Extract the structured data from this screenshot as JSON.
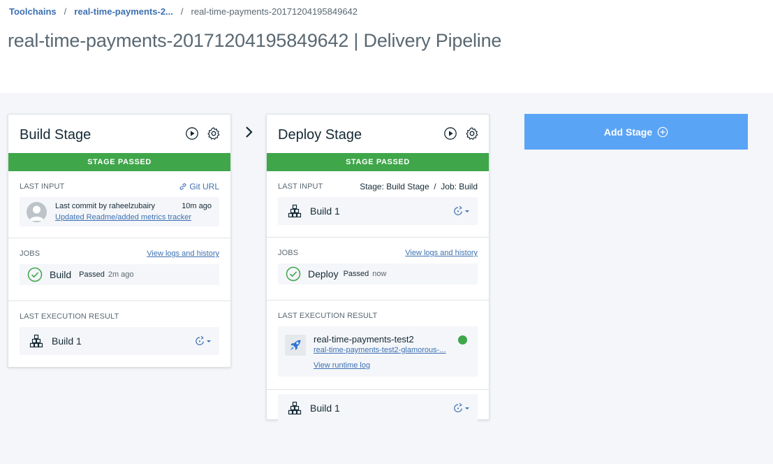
{
  "breadcrumb": {
    "root": "Toolchains",
    "parent": "real-time-payments-2...",
    "current": "real-time-payments-20171204195849642",
    "separator": "/"
  },
  "page": {
    "title": "real-time-payments-20171204195849642 | Delivery Pipeline"
  },
  "colors": {
    "accent": "#3d70b2",
    "passed": "#3fa64a",
    "add_stage": "#5aa4f5"
  },
  "build_stage": {
    "title": "Build Stage",
    "status": "STAGE PASSED",
    "last_input": {
      "label": "LAST INPUT",
      "git_link": "Git URL",
      "commit_by": "Last commit by raheelzubairy",
      "commit_time": "10m ago",
      "commit_message": "Updated Readme/added metrics tracker"
    },
    "jobs": {
      "label": "JOBS",
      "logs_link": "View logs and history",
      "job_name": "Build",
      "job_status": "Passed",
      "job_time": "2m ago"
    },
    "last_execution": {
      "label": "LAST EXECUTION RESULT",
      "build_name": "Build 1"
    }
  },
  "deploy_stage": {
    "title": "Deploy Stage",
    "status": "STAGE PASSED",
    "last_input": {
      "label": "LAST INPUT",
      "source": "Stage: Build Stage  /  Job: Build",
      "build_name": "Build 1"
    },
    "jobs": {
      "label": "JOBS",
      "logs_link": "View logs and history",
      "job_name": "Deploy",
      "job_status": "Passed",
      "job_time": "now"
    },
    "last_execution": {
      "label": "LAST EXECUTION RESULT",
      "app_name": "real-time-payments-test2",
      "app_url": "real-time-payments-test2-glamorous-...",
      "runtime_log": "View runtime log",
      "build_name": "Build 1"
    }
  },
  "add_stage": {
    "label": "Add Stage"
  },
  "icons": {
    "run": "play-icon",
    "settings": "gear-icon",
    "link": "link-icon",
    "success": "check-circle-icon",
    "build": "build-stack-icon",
    "redeploy": "redeploy-icon",
    "next": "chevron-right-icon",
    "add": "plus-circle-icon",
    "app": "rocket-icon",
    "status": "status-dot-icon"
  }
}
